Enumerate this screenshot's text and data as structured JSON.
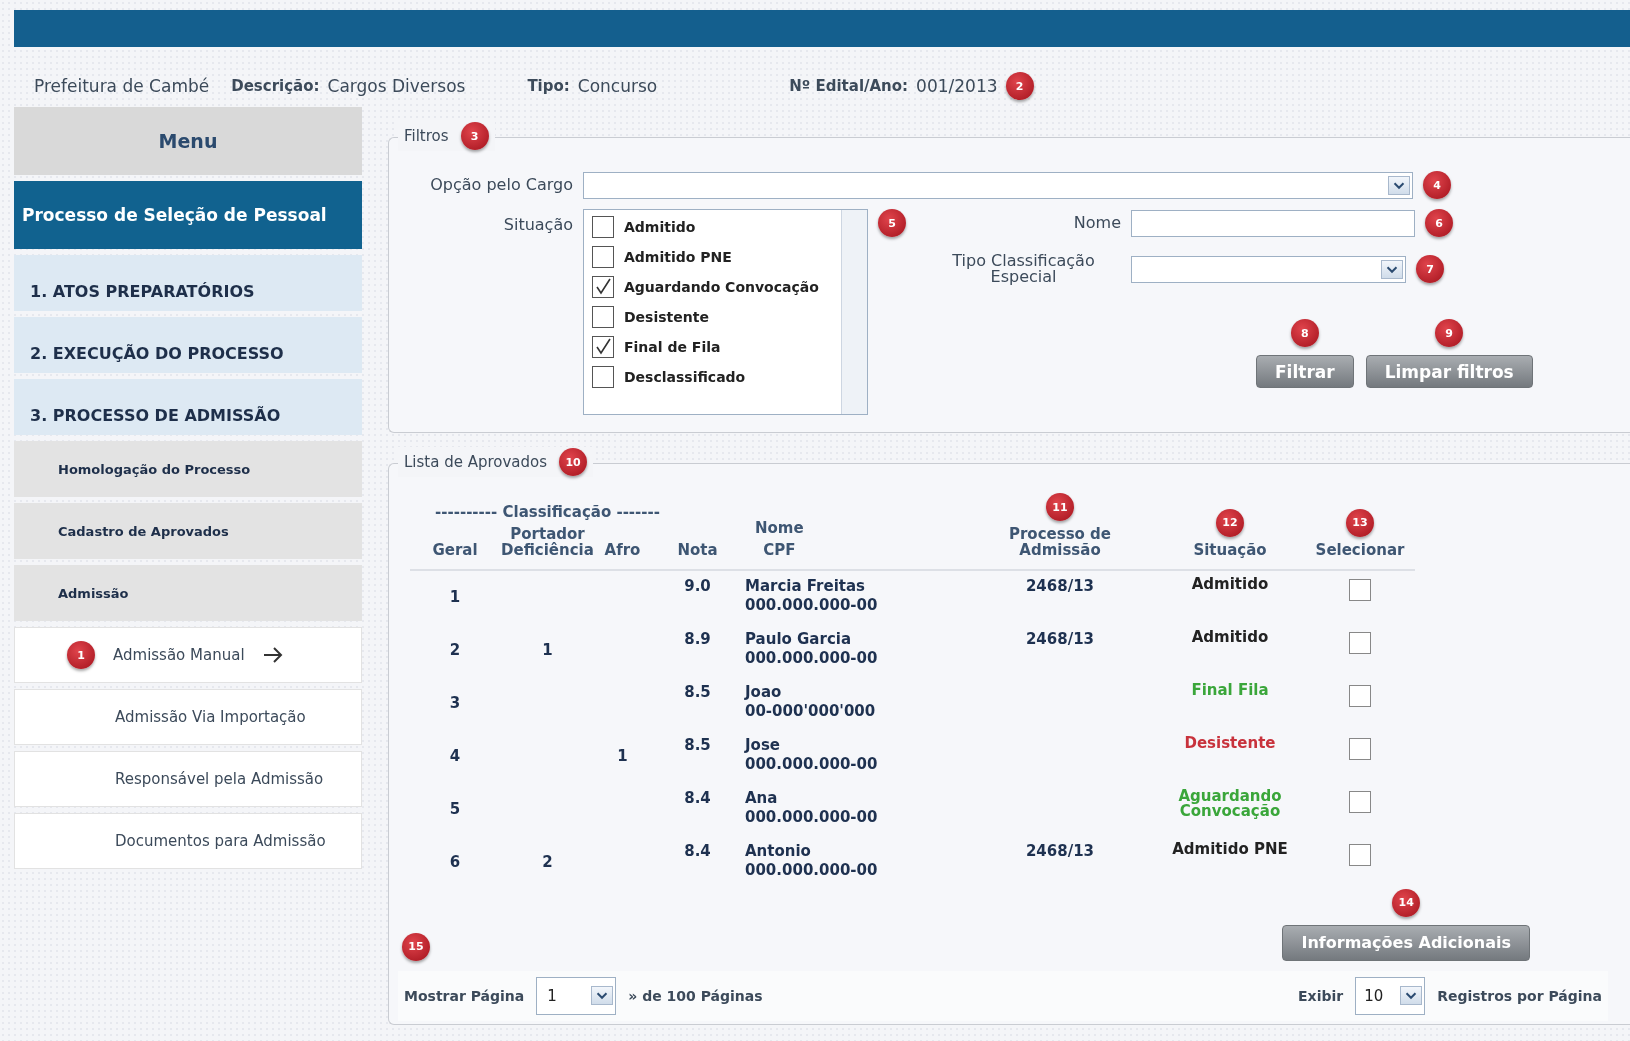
{
  "header": {
    "org": "Prefeitura de Cambé",
    "fields": [
      {
        "label": "Descrição:",
        "value": "Cargos Diversos"
      },
      {
        "label": "Tipo:",
        "value": "Concurso"
      },
      {
        "label": "Nº Edital/Ano:",
        "value": "001/2013"
      }
    ],
    "badge": "2"
  },
  "sidebar": {
    "title": "Menu",
    "section": "Processo de Seleção de Pessoal",
    "items": [
      {
        "kind": "group",
        "label": "1. ATOS PREPARATÓRIOS"
      },
      {
        "kind": "group",
        "label": "2. EXECUÇÃO DO PROCESSO"
      },
      {
        "kind": "group",
        "label": "3. PROCESSO DE ADMISSÃO"
      },
      {
        "kind": "sub",
        "label": "Homologação do Processo"
      },
      {
        "kind": "sub",
        "label": "Cadastro de Aprovados"
      },
      {
        "kind": "sub",
        "label": "Admissão"
      },
      {
        "kind": "link",
        "label": "Admissão Manual",
        "selected": true,
        "badge": "1"
      },
      {
        "kind": "link",
        "label": "Admissão Via Importação",
        "selected": false
      },
      {
        "kind": "link",
        "label": "Responsável pela Admissão",
        "selected": false
      },
      {
        "kind": "link",
        "label": "Documentos para Admissão",
        "selected": false
      }
    ]
  },
  "filters": {
    "legend": "Filtros",
    "badge": "3",
    "cargo": {
      "label": "Opção pelo Cargo",
      "badge": "4"
    },
    "situacao": {
      "label": "Situação",
      "badge": "5",
      "options": [
        {
          "label": "Admitido",
          "checked": false
        },
        {
          "label": "Admitido PNE",
          "checked": false
        },
        {
          "label": "Aguardando Convocação",
          "checked": true
        },
        {
          "label": "Desistente",
          "checked": false
        },
        {
          "label": "Final de Fila",
          "checked": true
        },
        {
          "label": "Desclassificado",
          "checked": false
        }
      ]
    },
    "nome": {
      "label": "Nome",
      "badge": "6"
    },
    "tipo": {
      "label": "Tipo Classificação Especial",
      "badge": "7"
    },
    "buttons": [
      {
        "label": "Filtrar",
        "badge": "8"
      },
      {
        "label": "Limpar filtros",
        "badge": "9"
      }
    ]
  },
  "list": {
    "legend": "Lista de Aprovados",
    "badge": "10",
    "group_header": "---------- Classificação -------",
    "columns": [
      {
        "label": "Geral"
      },
      {
        "label": "Portador Deficiência"
      },
      {
        "label": "Afro"
      },
      {
        "label": "Nota"
      },
      {
        "label": "Nome",
        "sub": "CPF"
      },
      {
        "label": "Processo de Admissão",
        "badge": "11"
      },
      {
        "label": "Situação",
        "badge": "12"
      },
      {
        "label": "Selecionar",
        "badge": "13"
      }
    ],
    "rows": [
      {
        "geral": "1",
        "portador": "",
        "afro": "",
        "nota": "9.0",
        "nome": "Marcia Freitas",
        "cpf": "000.000.000-00",
        "processo": "2468/13",
        "situacao": "Admitido",
        "color": "#222222",
        "selected": false
      },
      {
        "geral": "2",
        "portador": "1",
        "afro": "",
        "nota": "8.9",
        "nome": "Paulo Garcia",
        "cpf": "000.000.000-00",
        "processo": "2468/13",
        "situacao": "Admitido",
        "color": "#222222",
        "selected": false
      },
      {
        "geral": "3",
        "portador": "",
        "afro": "",
        "nota": "8.5",
        "nome": "Joao",
        "cpf": "00-000'000'000",
        "processo": "",
        "situacao": "Final Fila",
        "color": "#3aa63a",
        "selected": false
      },
      {
        "geral": "4",
        "portador": "",
        "afro": "1",
        "nota": "8.5",
        "nome": "Jose",
        "cpf": "000.000.000-00",
        "processo": "",
        "situacao": "Desistente",
        "color": "#c8323c",
        "selected": false
      },
      {
        "geral": "5",
        "portador": "",
        "afro": "",
        "nota": "8.4",
        "nome": "Ana",
        "cpf": "000.000.000-00",
        "processo": "",
        "situacao": "Aguardando Convocação",
        "color": "#3aa63a",
        "selected": false
      },
      {
        "geral": "6",
        "portador": "2",
        "afro": "",
        "nota": "8.4",
        "nome": "Antonio",
        "cpf": "000.000.000-00",
        "processo": "2468/13",
        "situacao": "Admitido PNE",
        "color": "#222222",
        "selected": false
      }
    ],
    "info_button": {
      "label": "Informações Adicionais",
      "badge": "14"
    },
    "pager": {
      "badge": "15",
      "show_label": "Mostrar Página",
      "page": "1",
      "of_pages": "» de 100 Páginas",
      "show": "Exibir",
      "per_page": "10",
      "per_page_label": "Registros por Página"
    }
  }
}
